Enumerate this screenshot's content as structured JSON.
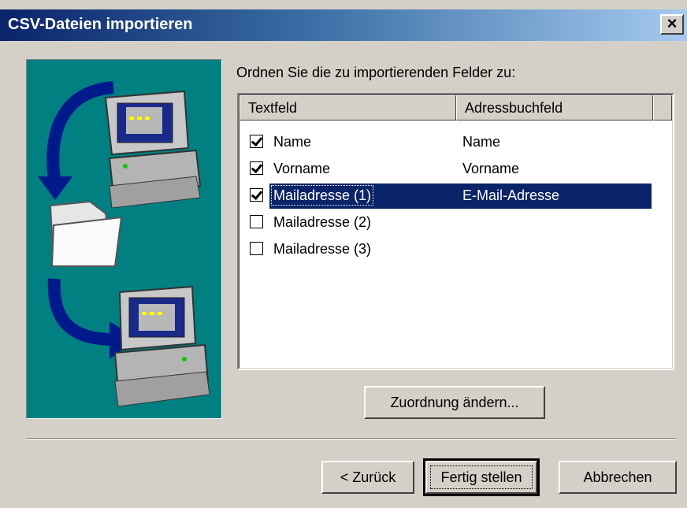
{
  "window": {
    "title": "CSV-Dateien importieren",
    "close_label": "×"
  },
  "prompt": "Ordnen Sie die zu importierenden Felder zu:",
  "table": {
    "columns": [
      "Textfeld",
      "Adressbuchfeld"
    ],
    "rows": [
      {
        "field": "Name",
        "mapped": "Name",
        "checked": true,
        "selected": false
      },
      {
        "field": "Vorname",
        "mapped": "Vorname",
        "checked": true,
        "selected": false
      },
      {
        "field": "Mailadresse (1)",
        "mapped": "E-Mail-Adresse",
        "checked": true,
        "selected": true
      },
      {
        "field": "Mailadresse (2)",
        "mapped": "",
        "checked": false,
        "selected": false
      },
      {
        "field": "Mailadresse (3)",
        "mapped": "",
        "checked": false,
        "selected": false
      }
    ]
  },
  "buttons": {
    "change_mapping": "Zuordnung ändern...",
    "back": "< Zurück",
    "finish": "Fertig stellen",
    "cancel": "Abbrechen"
  },
  "colors": {
    "titlebar": "#0a246a",
    "selection": "#0a246a",
    "illustration_bg": "#008080",
    "arrow": "#001a8c"
  },
  "icons": [
    "computer-icon",
    "folder-icon",
    "arrow-icon"
  ]
}
